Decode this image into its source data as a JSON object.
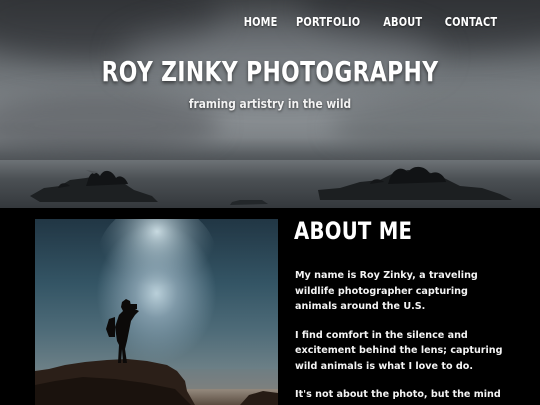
{
  "nav": {
    "items": [
      "HOME",
      "PORTFOLIO",
      "ABOUT",
      "CONTACT"
    ]
  },
  "hero": {
    "title": "ROY ZINKY PHOTOGRAPHY",
    "tagline": "framing artistry in the wild"
  },
  "about": {
    "heading": "ABOUT ME",
    "paragraphs": [
      "My name is Roy Zinky, a traveling wildlife photographer capturing animals around the U.S.",
      "I find comfort in the silence and excitement behind the lens; capturing wild animals is what I love to do.",
      "It's not about the photo, but the mind"
    ]
  },
  "colors": {
    "background": "#000000",
    "text": "#ffffff",
    "sky": "#7d8286"
  }
}
